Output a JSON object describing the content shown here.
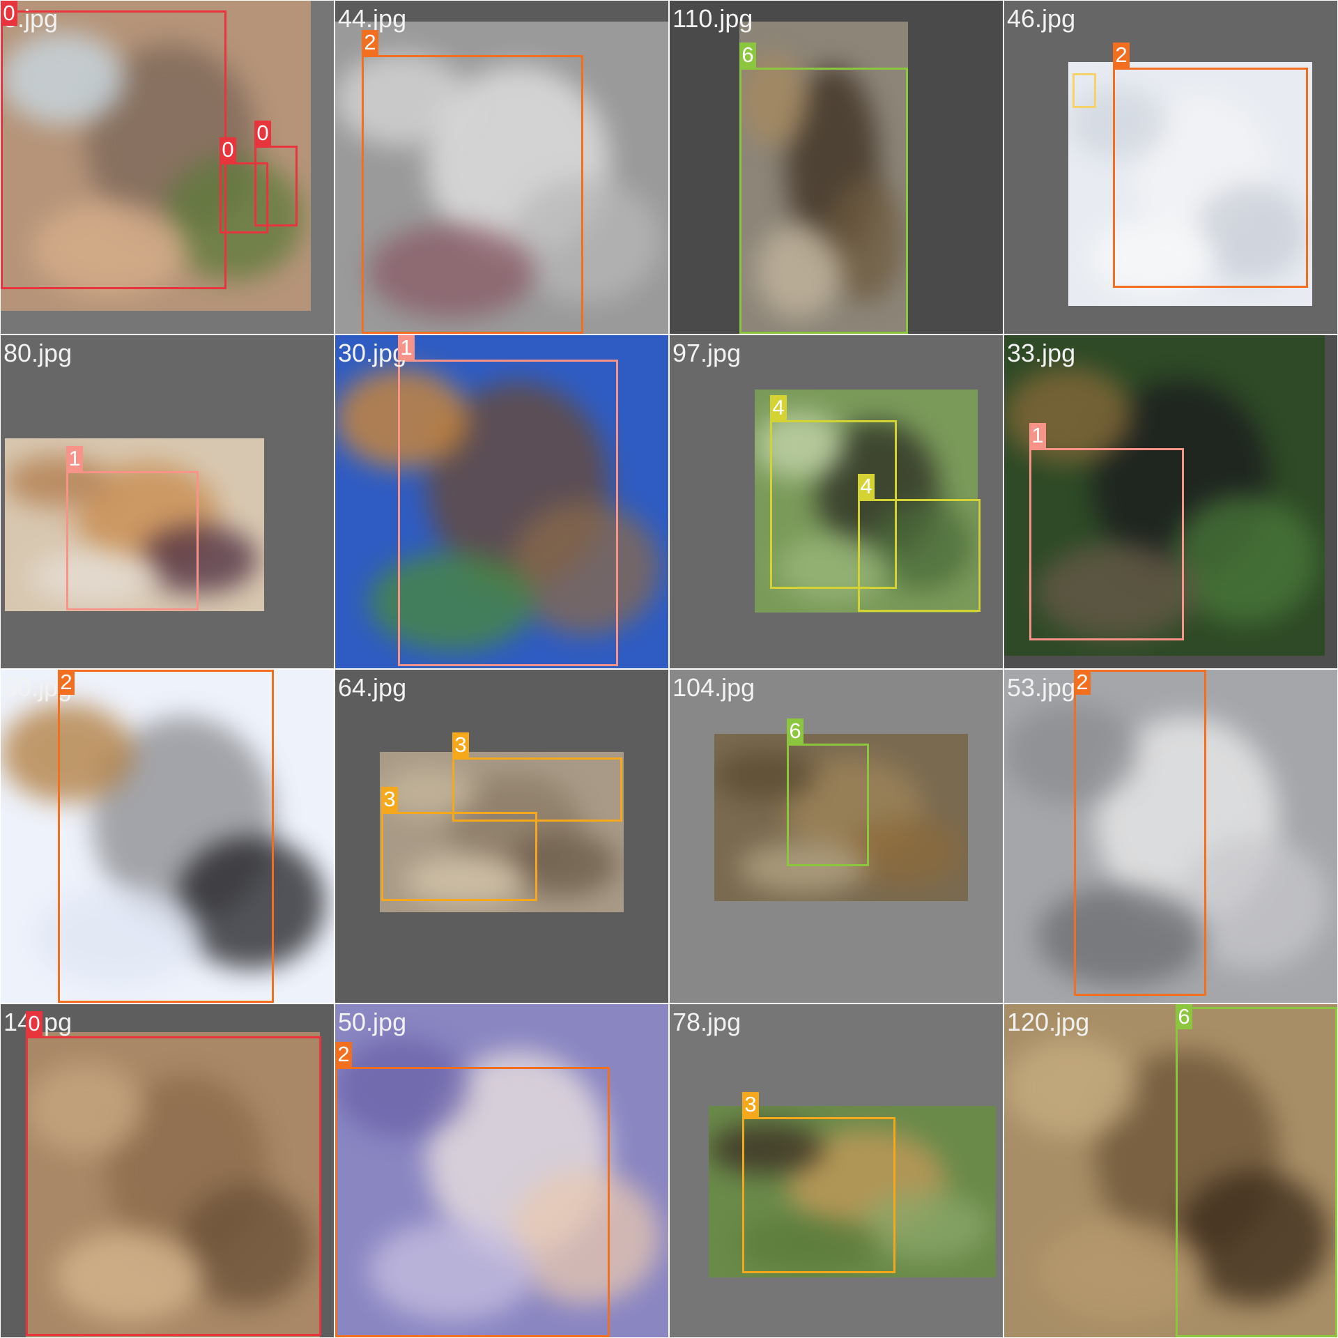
{
  "grid": {
    "columns": 4,
    "rows": 4
  },
  "class_colors": {
    "0": "#e8343d",
    "1": "#f79389",
    "2": "#f26f20",
    "3": "#f5a81c",
    "4": "#d4d333",
    "6": "#8cc63f"
  },
  "tiles": [
    {
      "filename": "5.jpg",
      "background": "#767676",
      "scene": {
        "base": "#b59479",
        "accents": [
          "#7a6658",
          "#c9ddea",
          "#5c7a3a",
          "#d9b08c"
        ]
      },
      "boxes": [
        {
          "label": "0",
          "icon": "elephant-box-icon"
        },
        {
          "label": "0",
          "icon": "elephant-calf-box-icon"
        },
        {
          "label": "0",
          "icon": "elephant-calf-box-icon"
        }
      ]
    },
    {
      "filename": "44.jpg",
      "background": "#5b5b5b",
      "scene": {
        "base": "#9a9a9a",
        "accents": [
          "#e6e6e6",
          "#d9d9d9",
          "#b8b8b8",
          "#8a5a66"
        ]
      },
      "boxes": [
        {
          "label": "2",
          "icon": "arctic-fox-box-icon"
        }
      ]
    },
    {
      "filename": "110.jpg",
      "background": "#4a4a4a",
      "scene": {
        "base": "#8c8578",
        "accents": [
          "#3a2c1e",
          "#a88a5e",
          "#6e5a3e",
          "#c6b8a0"
        ]
      },
      "boxes": [
        {
          "label": "6",
          "icon": "lion-box-icon"
        }
      ]
    },
    {
      "filename": "46.jpg",
      "background": "#666666",
      "scene": {
        "base": "#e8ecf2",
        "accents": [
          "#f4f4f6",
          "#d0d6de",
          "#c8cdd6",
          "#fafafa"
        ]
      },
      "boxes": [
        {
          "label": "2",
          "icon": "white-wolf-box-icon"
        },
        {
          "label": "",
          "icon": "small-box-icon"
        }
      ]
    },
    {
      "filename": "80.jpg",
      "background": "#676767",
      "scene": {
        "base": "#d8c7b0",
        "accents": [
          "#c8894a",
          "#b07a4a",
          "#4a2a3e",
          "#e6e0d8"
        ]
      },
      "boxes": [
        {
          "label": "1",
          "icon": "cheetah-cub-box-icon"
        }
      ]
    },
    {
      "filename": "30.jpg",
      "background": "#3b5fa8",
      "scene": {
        "base": "#2f5cc2",
        "accents": [
          "#6b4a32",
          "#d88a2e",
          "#8a6a4a",
          "#4a8a3a"
        ]
      },
      "boxes": [
        {
          "label": "1",
          "icon": "leopard-box-icon"
        }
      ]
    },
    {
      "filename": "97.jpg",
      "background": "#696969",
      "scene": {
        "base": "#7a9a5a",
        "accents": [
          "#2a2a22",
          "#c8d8b0",
          "#4a6a3a",
          "#9ab87a"
        ]
      },
      "boxes": [
        {
          "label": "4",
          "icon": "chimpanzee-box-icon"
        },
        {
          "label": "4",
          "icon": "chimpanzee-box-icon"
        }
      ]
    },
    {
      "filename": "33.jpg",
      "background": "#4e4e4e",
      "scene": {
        "base": "#2e4a26",
        "accents": [
          "#1a1a1e",
          "#8a6a3a",
          "#4a7a3a",
          "#6a5a4a"
        ]
      },
      "boxes": [
        {
          "label": "1",
          "icon": "leopard-box-icon"
        }
      ]
    },
    {
      "filename": "60.jpg",
      "background": "#f2f4fa",
      "scene": {
        "base": "#eef2fb",
        "accents": [
          "#8a8a8e",
          "#b07a3a",
          "#1e1e22",
          "#dfe6f4"
        ]
      },
      "boxes": [
        {
          "label": "2",
          "icon": "wolf-face-box-icon"
        }
      ]
    },
    {
      "filename": "64.jpg",
      "background": "#5d5d5d",
      "scene": {
        "base": "#a89a86",
        "accents": [
          "#8a7a66",
          "#c8b89e",
          "#6a5a48",
          "#d8c8ae"
        ]
      },
      "boxes": [
        {
          "label": "3",
          "icon": "cheetah-box-icon"
        },
        {
          "label": "3",
          "icon": "cheetah-box-icon"
        }
      ]
    },
    {
      "filename": "104.jpg",
      "background": "#888888",
      "scene": {
        "base": "#7a6a50",
        "accents": [
          "#a0865a",
          "#5a4a30",
          "#8c6a3a",
          "#b8a888"
        ]
      },
      "boxes": [
        {
          "label": "6",
          "icon": "lion-box-icon"
        }
      ]
    },
    {
      "filename": "53.jpg",
      "background": "#7a7a7a",
      "scene": {
        "base": "#a4a6aa",
        "accents": [
          "#eeeeee",
          "#8a8c90",
          "#c8c8cc",
          "#6a6c70"
        ]
      },
      "boxes": [
        {
          "label": "2",
          "icon": "arctic-fox-box-icon"
        }
      ]
    },
    {
      "filename": "14.jpg",
      "background": "#5e5e5e",
      "scene": {
        "base": "#a88866",
        "accents": [
          "#8a6a4a",
          "#c8a882",
          "#6a5038",
          "#d8b890"
        ]
      },
      "boxes": [
        {
          "label": "0",
          "icon": "elephant-box-icon"
        }
      ]
    },
    {
      "filename": "50.jpg",
      "background": "#6a6a9a",
      "scene": {
        "base": "#8a86c2",
        "accents": [
          "#f0e6e0",
          "#6a62a8",
          "#e8c8b0",
          "#c8c0e0"
        ]
      },
      "boxes": [
        {
          "label": "2",
          "icon": "arctic-fox-box-icon"
        }
      ]
    },
    {
      "filename": "78.jpg",
      "background": "#767676",
      "scene": {
        "base": "#6a8a4a",
        "accents": [
          "#c89a5a",
          "#3a2a22",
          "#8aa86a",
          "#5a7a3a"
        ]
      },
      "boxes": [
        {
          "label": "3",
          "icon": "cheetah-box-icon"
        }
      ]
    },
    {
      "filename": "120.jpg",
      "background": "#8a7454",
      "scene": {
        "base": "#a88e66",
        "accents": [
          "#6a5236",
          "#c8ae82",
          "#3a2a1a",
          "#b89a6e"
        ]
      },
      "boxes": [
        {
          "label": "6",
          "icon": "lion-box-icon"
        }
      ]
    }
  ]
}
